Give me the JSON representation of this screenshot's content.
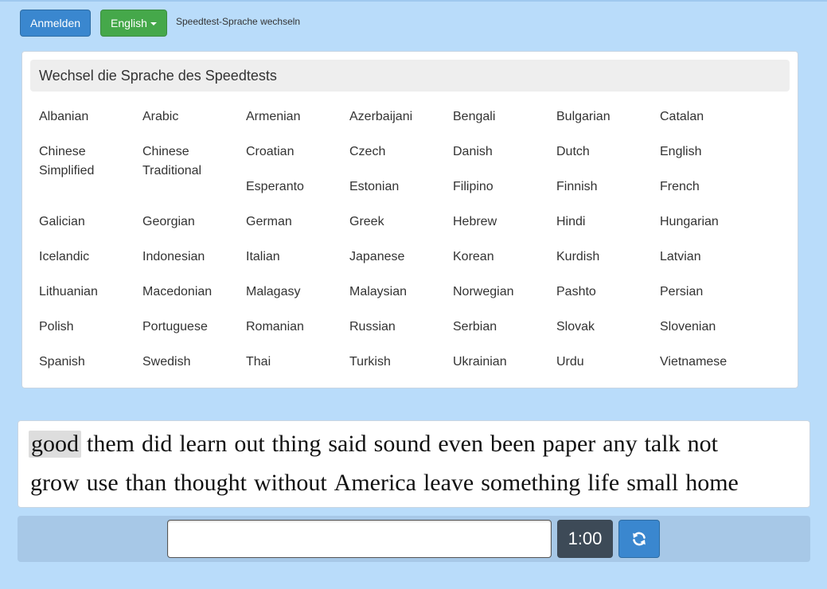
{
  "topbar": {
    "login_label": "Anmelden",
    "language_label": "English",
    "hint": "Speedtest-Sprache wechseln"
  },
  "language_panel": {
    "title": "Wechsel die Sprache des Speedtests",
    "rows": [
      [
        "Albanian",
        "Arabic",
        "Armenian",
        "Azerbaijani",
        "Bengali",
        "Bulgarian",
        "Catalan"
      ],
      [
        "Chinese Simplified",
        "Chinese Traditional",
        "Croatian",
        "Czech",
        "Danish",
        "Dutch",
        "English"
      ],
      [
        "",
        "",
        "Esperanto",
        "Estonian",
        "Filipino",
        "Finnish",
        "French"
      ],
      [
        "Galician",
        "Georgian",
        "German",
        "Greek",
        "Hebrew",
        "Hindi",
        "Hungarian"
      ],
      [
        "Icelandic",
        "Indonesian",
        "Italian",
        "Japanese",
        "Korean",
        "Kurdish",
        "Latvian"
      ],
      [
        "Lithuanian",
        "Macedonian",
        "Malagasy",
        "Malaysian",
        "Norwegian",
        "Pashto",
        "Persian"
      ],
      [
        "Polish",
        "Portuguese",
        "Romanian",
        "Russian",
        "Serbian",
        "Slovak",
        "Slovenian"
      ],
      [
        "Spanish",
        "Swedish",
        "Thai",
        "Turkish",
        "Ukrainian",
        "Urdu",
        "Vietnamese"
      ]
    ]
  },
  "typing": {
    "line1": [
      "good",
      "them",
      "did",
      "learn",
      "out",
      "thing",
      "said",
      "sound",
      "even",
      "been",
      "paper",
      "any",
      "talk",
      "not"
    ],
    "line2": [
      "grow",
      "use",
      "than",
      "thought",
      "without",
      "America",
      "leave",
      "something",
      "life",
      "small",
      "home"
    ],
    "current_word_index": 0
  },
  "controls": {
    "input_value": "",
    "timer": "1:00",
    "reload_icon": "refresh-icon"
  },
  "colors": {
    "background": "#b9dcfa",
    "login_button": "#3a87cf",
    "language_button": "#45a84a",
    "timer_bg": "#3d4a57",
    "current_word_highlight": "#dddddd"
  }
}
